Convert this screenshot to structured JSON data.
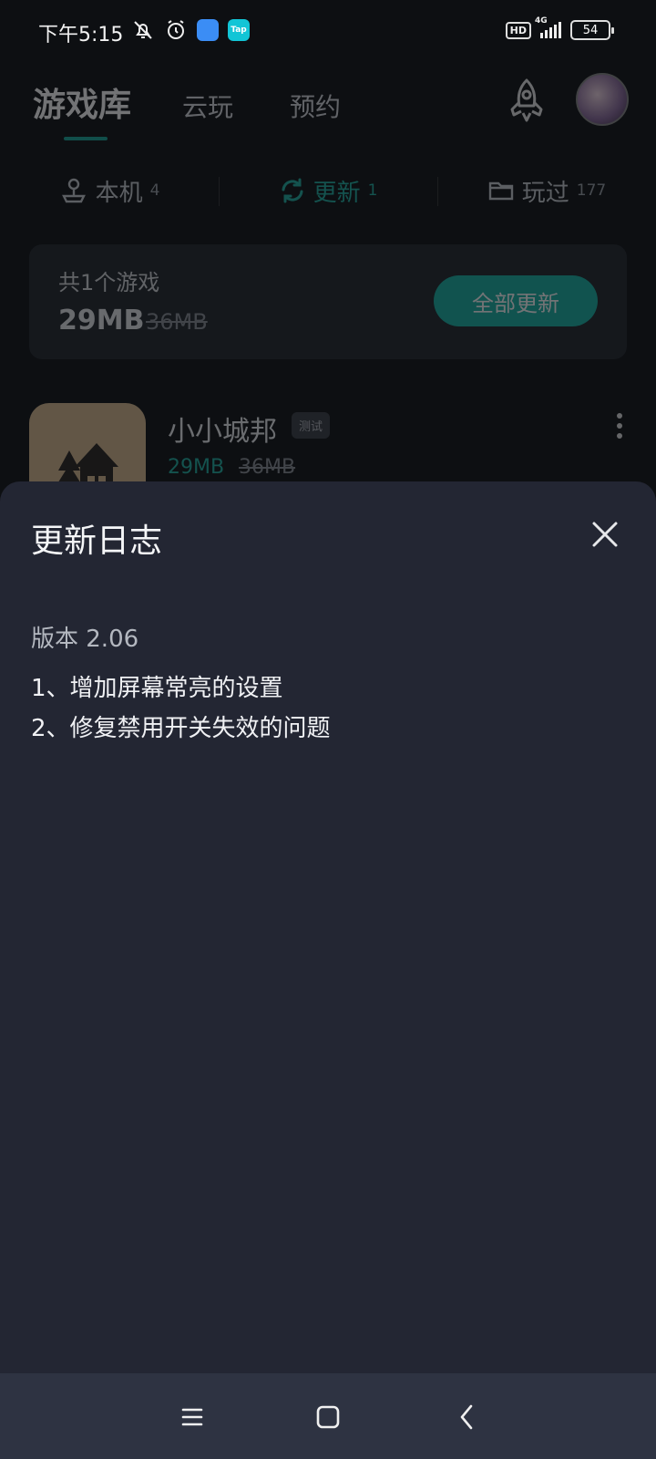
{
  "status_bar": {
    "time": "下午5:15",
    "network_hd": "HD",
    "network_type": "4G",
    "battery": "54",
    "app_badge_tap": "Tap"
  },
  "top_tabs": {
    "library": "游戏库",
    "cloud": "云玩",
    "reserve": "预约"
  },
  "sub_tabs": [
    {
      "label": "本机",
      "count": "4"
    },
    {
      "label": "更新",
      "count": "1"
    },
    {
      "label": "玩过",
      "count": "177"
    }
  ],
  "summary": {
    "count_text": "共1个游戏",
    "size": "29MB",
    "old_size": "36MB",
    "update_all": "全部更新"
  },
  "game": {
    "name": "小小城邦",
    "tag": "测试",
    "size": "29MB",
    "old_size": "36MB"
  },
  "changelog": {
    "title": "更新日志",
    "version": "版本 2.06",
    "notes": [
      "1、增加屏幕常亮的设置",
      "2、修复禁用开关失效的问题"
    ]
  },
  "colors": {
    "accent": "#18b3a4",
    "sheet": "#232633",
    "background": "#0d0f12"
  },
  "icons": [
    "mute-icon",
    "alarm-icon",
    "rocket-icon",
    "close-icon",
    "menu-icon",
    "home-icon",
    "back-icon"
  ]
}
